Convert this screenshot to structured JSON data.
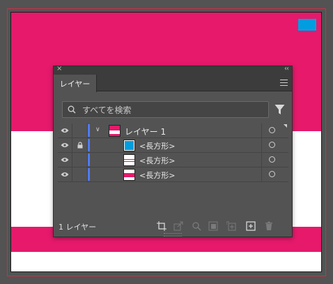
{
  "colors": {
    "artboard_pink": "#e6196b",
    "small_rect_blue": "#009ee0",
    "panel_bg": "#535353",
    "layer_color": "#4f7bff"
  },
  "panel": {
    "close_glyph": "×",
    "collapse_glyph": "‹‹",
    "tab_label": "レイヤー",
    "menu_icon": "hamburger-menu-icon",
    "search_placeholder": "すべてを検索",
    "filter_icon": "filter-icon"
  },
  "layers": [
    {
      "name": "レイヤー 1",
      "visible": true,
      "locked": false,
      "expanded": true,
      "thumb": "layer-thumb"
    },
    {
      "name": "<長方形>",
      "visible": true,
      "locked": true,
      "thumb": "blue-rect-thumb"
    },
    {
      "name": "<長方形>",
      "visible": true,
      "locked": false,
      "thumb": "white-rect-thumb"
    },
    {
      "name": "<長方形>",
      "visible": true,
      "locked": false,
      "thumb": "pink-rect-thumb"
    }
  ],
  "footer": {
    "count_label": "1 レイヤー",
    "icons": [
      "collect-for-export-icon",
      "export-icon",
      "locate-object-icon",
      "make-clipping-mask-icon",
      "create-sublayer-icon",
      "create-new-layer-icon",
      "delete-layer-icon"
    ]
  }
}
